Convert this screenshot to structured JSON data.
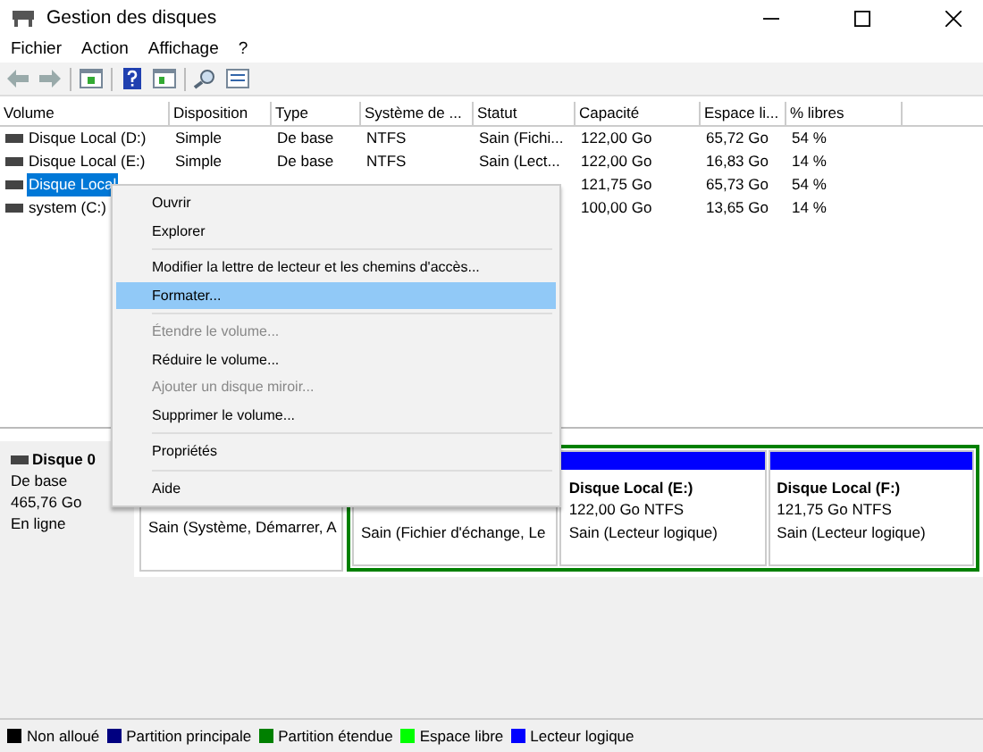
{
  "window": {
    "title": "Gestion des disques"
  },
  "menubar": [
    "Fichier",
    "Action",
    "Affichage",
    "?"
  ],
  "table": {
    "columns": [
      "Volume",
      "Disposition",
      "Type",
      "Système de ...",
      "Statut",
      "Capacité",
      "Espace li...",
      "% libres"
    ],
    "rows": [
      {
        "selected": false,
        "cells": [
          "Disque Local (D:)",
          "Simple",
          "De base",
          "NTFS",
          "Sain (Fichi...",
          "122,00 Go",
          "65,72 Go",
          "54 %"
        ]
      },
      {
        "selected": false,
        "cells": [
          "Disque Local (E:)",
          "Simple",
          "De base",
          "NTFS",
          "Sain (Lect...",
          "122,00 Go",
          "16,83 Go",
          "14 %"
        ]
      },
      {
        "selected": true,
        "cells": [
          "Disque Local",
          "",
          "",
          "",
          "",
          "121,75 Go",
          "65,73 Go",
          "54 %"
        ]
      },
      {
        "selected": false,
        "cells": [
          "system (C:)",
          "",
          "",
          "",
          "",
          "100,00 Go",
          "13,65 Go",
          "14 %"
        ]
      }
    ]
  },
  "context_menu": [
    {
      "kind": "item",
      "label": "Ouvrir",
      "disabled": false,
      "selected": false
    },
    {
      "kind": "item",
      "label": "Explorer",
      "disabled": false,
      "selected": false
    },
    {
      "kind": "separator"
    },
    {
      "kind": "item",
      "label": "Modifier la lettre de lecteur et les chemins d'accès...",
      "disabled": false,
      "selected": false
    },
    {
      "kind": "item",
      "label": "Formater...",
      "disabled": false,
      "selected": true
    },
    {
      "kind": "separator"
    },
    {
      "kind": "item",
      "label": "Étendre le volume...",
      "disabled": true,
      "selected": false
    },
    {
      "kind": "item",
      "label": "Réduire le volume...",
      "disabled": false,
      "selected": false
    },
    {
      "kind": "item",
      "label": "Ajouter un disque miroir...",
      "disabled": true,
      "selected": false
    },
    {
      "kind": "item",
      "label": "Supprimer le volume...",
      "disabled": false,
      "selected": false
    },
    {
      "kind": "separator"
    },
    {
      "kind": "item",
      "label": "Propriétés",
      "disabled": false,
      "selected": false
    },
    {
      "kind": "separator"
    },
    {
      "kind": "item",
      "label": "Aide",
      "disabled": false,
      "selected": false
    }
  ],
  "disk": {
    "name": "Disque 0",
    "lines": [
      "De base",
      "465,76 Go",
      "En ligne"
    ],
    "partitions": [
      {
        "kind": "primary",
        "lines": [
          "Sain (Système, Démarrer, A"
        ]
      },
      {
        "kind": "logical",
        "lines": [
          "Sain (Fichier d'échange, Le"
        ]
      },
      {
        "kind": "logical",
        "title": "Disque Local  (E:)",
        "lines": [
          "122,00 Go NTFS",
          "Sain (Lecteur logique)"
        ]
      },
      {
        "kind": "logical",
        "title": "Disque Local  (F:)",
        "lines": [
          "121,75 Go NTFS",
          "Sain (Lecteur logique)"
        ]
      }
    ]
  },
  "legend": [
    {
      "label": "Non alloué",
      "color": "#000000"
    },
    {
      "label": "Partition principale",
      "color": "#000080"
    },
    {
      "label": "Partition étendue",
      "color": "#008000"
    },
    {
      "label": "Espace libre",
      "color": "#00ff00"
    },
    {
      "label": "Lecteur logique",
      "color": "#0000ff"
    }
  ]
}
